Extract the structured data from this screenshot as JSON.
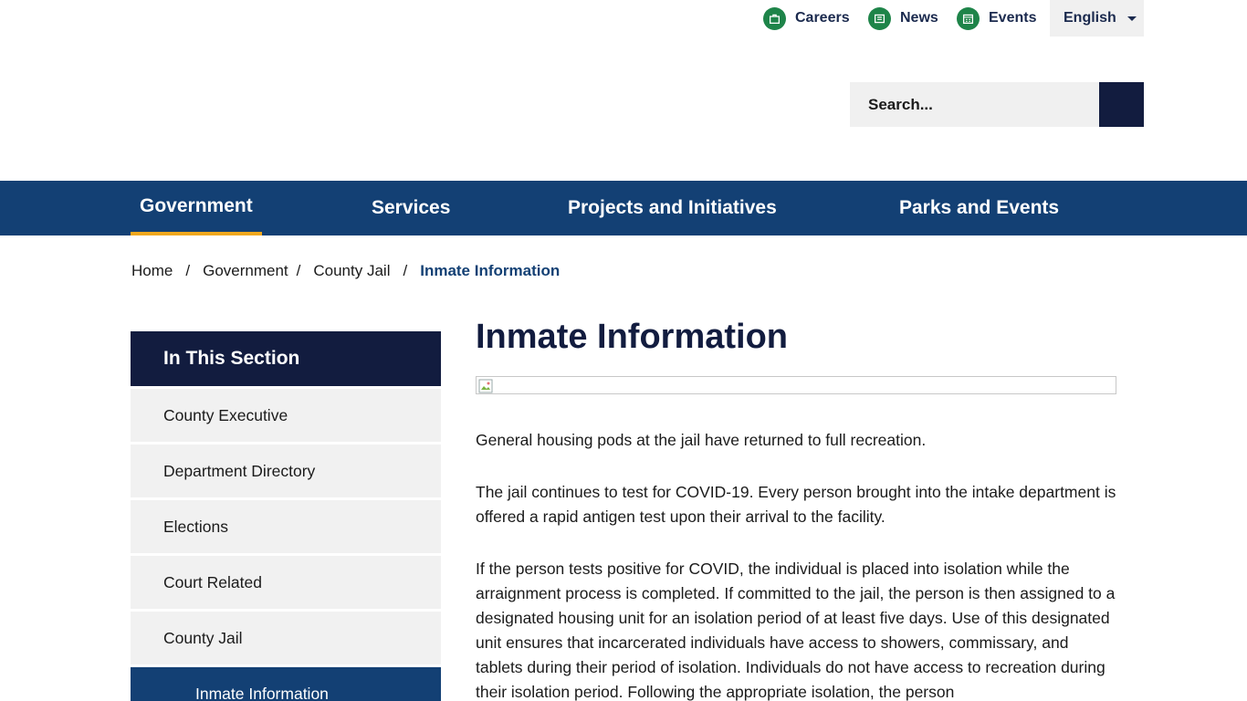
{
  "utility": {
    "careers": "Careers",
    "news": "News",
    "events": "Events",
    "language": "English"
  },
  "search": {
    "placeholder": "Search..."
  },
  "nav": {
    "items": [
      "Government",
      "Services",
      "Projects and Initiatives",
      "Parks and Events"
    ],
    "active": "Government"
  },
  "breadcrumb": {
    "items": [
      "Home",
      "Government",
      "County Jail",
      "Inmate Information"
    ]
  },
  "sidebar": {
    "heading": "In This Section",
    "items": [
      "County Executive",
      "Department Directory",
      "Elections",
      "Court Related",
      "County Jail",
      "Inmate Information"
    ]
  },
  "main": {
    "title": "Inmate Information",
    "paragraphs": [
      "General housing pods at the jail have returned to full recreation.",
      "The jail continues to test for COVID-19. Every person brought into the intake department is offered a rapid antigen test upon their arrival to the facility.",
      "If the person tests positive for COVID, the individual is placed into isolation while the arraignment process is completed. If committed to the jail, the person is then assigned to a designated housing unit for an isolation period of at least five days. Use of this designated unit ensures that incarcerated individuals have access to showers, commissary, and tablets during their period of isolation. Individuals do not have access to recreation during their isolation period. Following the appropriate isolation, the person"
    ]
  },
  "colors": {
    "navy": "#121c3f",
    "nav_blue": "#134074",
    "accent_gold": "#f0a81e",
    "icon_green": "#1e8449"
  }
}
